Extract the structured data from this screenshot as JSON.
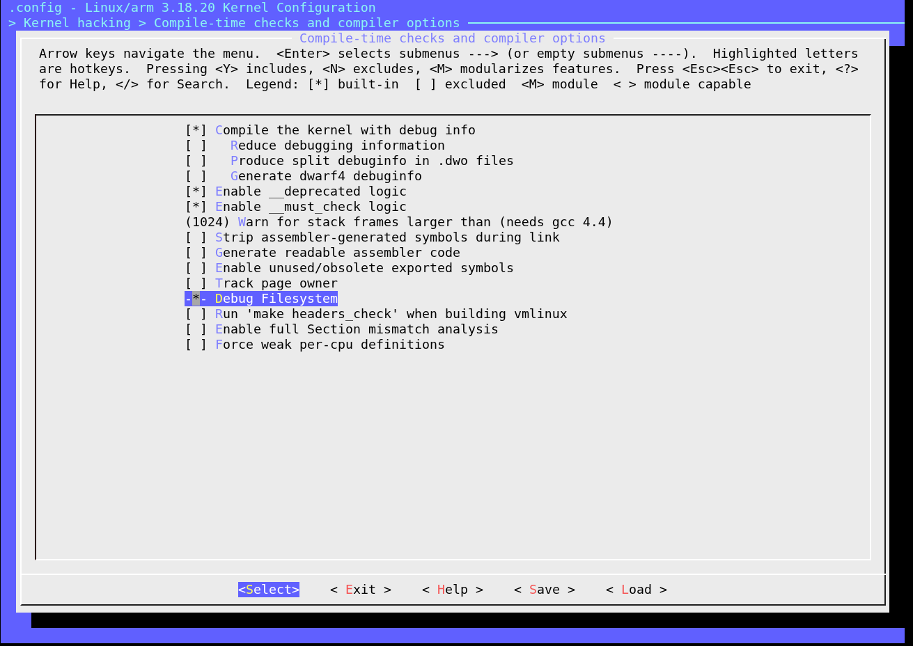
{
  "window": {
    "title": ".config - Linux/arm 3.18.20 Kernel Configuration"
  },
  "breadcrumb": "> Kernel hacking > Compile-time checks and compiler options",
  "dialog": {
    "title": "Compile-time checks and compiler options",
    "help_text": "Arrow keys navigate the menu.  <Enter> selects submenus ---> (or empty submenus ----).  Highlighted letters are hotkeys.  Pressing <Y> includes, <N> excludes, <M> modularizes features.  Press <Esc><Esc> to exit, <?> for Help, </> for Search.  Legend: [*] built-in  [ ] excluded  <M> module  < > module capable",
    "menu": {
      "items": [
        {
          "marker": "[*]",
          "label": "Compile the kernel with debug info",
          "selected": false,
          "children": [
            {
              "marker": "[ ]",
              "label": "Reduce debugging information",
              "selected": false
            },
            {
              "marker": "[ ]",
              "label": "Produce split debuginfo in .dwo files",
              "selected": false
            },
            {
              "marker": "[ ]",
              "label": "Generate dwarf4 debuginfo",
              "selected": false
            }
          ]
        },
        {
          "marker": "[*]",
          "label": "Enable __deprecated logic",
          "selected": false
        },
        {
          "marker": "[*]",
          "label": "Enable __must_check logic",
          "selected": false
        },
        {
          "marker": "(1024)",
          "label": "Warn for stack frames larger than (needs gcc 4.4)",
          "selected": false
        },
        {
          "marker": "[ ]",
          "label": "Strip assembler-generated symbols during link",
          "selected": false
        },
        {
          "marker": "[ ]",
          "label": "Generate readable assembler code",
          "selected": false
        },
        {
          "marker": "[ ]",
          "label": "Enable unused/obsolete exported symbols",
          "selected": false
        },
        {
          "marker": "[ ]",
          "label": "Track page owner",
          "selected": false
        },
        {
          "marker": "-*-",
          "label": "Debug Filesystem",
          "selected": true
        },
        {
          "marker": "[ ]",
          "label": "Run 'make headers_check' when building vmlinux",
          "selected": false
        },
        {
          "marker": "[ ]",
          "label": "Enable full Section mismatch analysis",
          "selected": false
        },
        {
          "marker": "[ ]",
          "label": "Force weak per-cpu definitions",
          "selected": false
        }
      ]
    },
    "buttons": [
      {
        "label": "<Select>",
        "selected": true
      },
      {
        "label": "< Exit >",
        "selected": false
      },
      {
        "label": "< Help >",
        "selected": false
      },
      {
        "label": "< Save >",
        "selected": false
      },
      {
        "label": "< Load >",
        "selected": false
      }
    ]
  }
}
